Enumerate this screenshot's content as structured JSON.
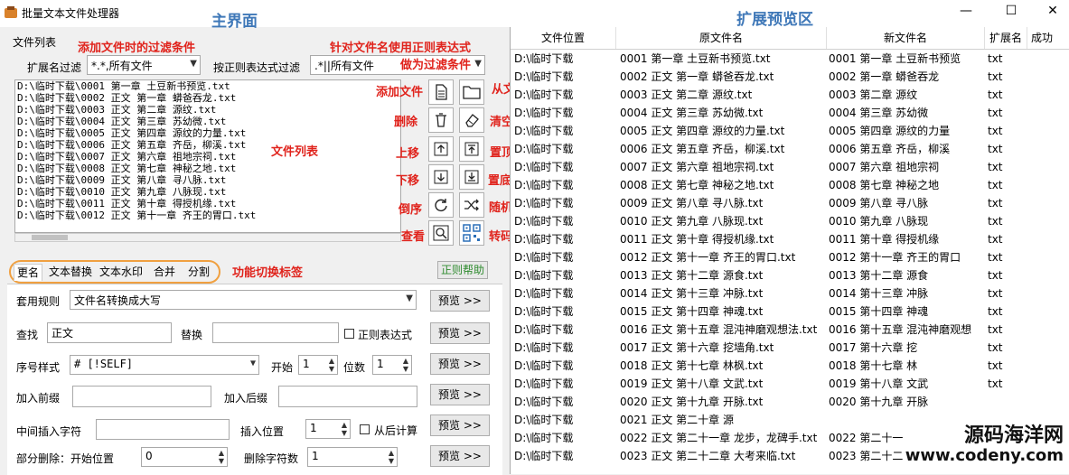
{
  "window": {
    "title": "批量文本文件处理器",
    "minimize": "—",
    "maximize": "☐",
    "close": "✕"
  },
  "annotations": {
    "main": "主界面",
    "preview": "扩展预览区",
    "filter_note": "添加文件时的过滤条件",
    "regex_note": "针对文件名使用正则表达式",
    "regex_note2": "做为过滤条件",
    "add_file": "添加文件",
    "add_folder": "从文件夹添加",
    "delete": "删除",
    "clear": "清空",
    "up": "上移",
    "top": "置顶",
    "down": "下移",
    "bottom": "置底",
    "reverse": "倒序",
    "random": "随机",
    "view": "查看",
    "transcode": "转码",
    "file_list": "文件列表",
    "tab_note": "功能切换标签"
  },
  "filter": {
    "section_label": "文件列表",
    "ext_label": "扩展名过滤",
    "ext_value": "*.*,所有文件",
    "regex_label": "按正则表达式过滤",
    "regex_value": ".*||所有文件"
  },
  "file_list": [
    "D:\\临时下载\\0001 第一章 土豆新书预览.txt",
    "D:\\临时下载\\0002 正文 第一章 蟒爸吞龙.txt",
    "D:\\临时下载\\0003 正文 第二章  源纹.txt",
    "D:\\临时下载\\0004 正文 第三章  苏幼微.txt",
    "D:\\临时下载\\0005 正文 第四章 源纹的力量.txt",
    "D:\\临时下载\\0006 正文 第五章  齐岳，柳溪.txt",
    "D:\\临时下载\\0007 正文 第六章  祖地宗祠.txt",
    "D:\\临时下载\\0008 正文 第七章 神秘之地.txt",
    "D:\\临时下载\\0009 正文 第八章 寻八脉.txt",
    "D:\\临时下载\\0010 正文 第九章  八脉现.txt",
    "D:\\临时下载\\0011 正文 第十章 得授机缘.txt",
    "D:\\临时下载\\0012 正文 第十一章  齐王的胃口.txt"
  ],
  "tabs": [
    "更名",
    "文本替换",
    "文本水印",
    "合并",
    "分割"
  ],
  "regex_help": "正则帮助",
  "rename": {
    "rule_label": "套用规则",
    "rule_value": "文件名转换成大写",
    "find_label": "查找",
    "find_value": "正文",
    "replace_label": "替换",
    "replace_value": "",
    "regex_check": "正则表达式",
    "seq_label": "序号样式",
    "seq_value": "# [!SELF]",
    "start_label": "开始",
    "start_value": "1",
    "digits_label": "位数",
    "digits_value": "1",
    "prefix_label": "加入前缀",
    "suffix_label": "加入后缀",
    "insert_label": "中间插入字符",
    "insert_pos_label": "插入位置",
    "insert_pos_value": "1",
    "from_end": "从后计算",
    "partdel_label": "部分删除：开始位置",
    "partdel_start": "0",
    "delcount_label": "删除字符数",
    "delcount_value": "1",
    "preview_btn": "预览 >>"
  },
  "grid": {
    "columns": [
      "文件位置",
      "原文件名",
      "新文件名",
      "扩展名",
      "成功"
    ],
    "rows": [
      [
        "D:\\临时下载",
        "0001 第一章 土豆新书预览.txt",
        "0001 第一章 土豆新书预览",
        "txt"
      ],
      [
        "D:\\临时下载",
        "0002 正文 第一章 蟒爸吞龙.txt",
        "0002 第一章 蟒爸吞龙",
        "txt"
      ],
      [
        "D:\\临时下载",
        "0003 正文 第二章  源纹.txt",
        "0003 第二章  源纹",
        "txt"
      ],
      [
        "D:\\临时下载",
        "0004 正文 第三章  苏幼微.txt",
        "0004 第三章  苏幼微",
        "txt"
      ],
      [
        "D:\\临时下载",
        "0005 正文 第四章 源纹的力量.txt",
        "0005 第四章 源纹的力量",
        "txt"
      ],
      [
        "D:\\临时下载",
        "0006 正文 第五章  齐岳，柳溪.txt",
        "0006 第五章  齐岳，柳溪",
        "txt"
      ],
      [
        "D:\\临时下载",
        "0007 正文 第六章  祖地宗祠.txt",
        "0007 第六章  祖地宗祠",
        "txt"
      ],
      [
        "D:\\临时下载",
        "0008 正文 第七章 神秘之地.txt",
        "0008 第七章 神秘之地",
        "txt"
      ],
      [
        "D:\\临时下载",
        "0009 正文 第八章 寻八脉.txt",
        "0009 第八章 寻八脉",
        "txt"
      ],
      [
        "D:\\临时下载",
        "0010 正文 第九章  八脉现.txt",
        "0010 第九章  八脉现",
        "txt"
      ],
      [
        "D:\\临时下载",
        "0011 正文 第十章 得授机缘.txt",
        "0011 第十章 得授机缘",
        "txt"
      ],
      [
        "D:\\临时下载",
        "0012 正文 第十一章  齐王的胃口.txt",
        "0012 第十一章  齐王的胃口",
        "txt"
      ],
      [
        "D:\\临时下载",
        "0013 正文 第十二章  源食.txt",
        "0013 第十二章  源食",
        "txt"
      ],
      [
        "D:\\临时下载",
        "0014 正文 第十三章  冲脉.txt",
        "0014 第十三章  冲脉",
        "txt"
      ],
      [
        "D:\\临时下载",
        "0015 正文 第十四章  神魂.txt",
        "0015 第十四章  神魂",
        "txt"
      ],
      [
        "D:\\临时下载",
        "0016 正文 第十五章  混沌神磨观想法.txt",
        "0016 第十五章  混沌神磨观想",
        "txt"
      ],
      [
        "D:\\临时下载",
        "0017 正文 第十六章 挖墙角.txt",
        "0017 第十六章 挖",
        "txt"
      ],
      [
        "D:\\临时下载",
        "0018 正文 第十七章  林枫.txt",
        "0018 第十七章  林",
        "txt"
      ],
      [
        "D:\\临时下载",
        "0019 正文 第十八章  文武.txt",
        "0019 第十八章  文武",
        "txt"
      ],
      [
        "D:\\临时下载",
        "0020 正文 第十九章  开脉.txt",
        "0020 第十九章  开脉",
        ""
      ],
      [
        "D:\\临时下载",
        "0021 正文 第二十章  源",
        "",
        ""
      ],
      [
        "D:\\临时下载",
        "0022 正文 第二十一章  龙步，龙碑手.txt",
        "0022 第二十一",
        ""
      ],
      [
        "D:\\临时下载",
        "0023 正文 第二十二章  大考来临.txt",
        "0023 第二十二",
        ""
      ]
    ]
  },
  "watermark": {
    "line1": "源码海洋网",
    "line2": "www.codeny.com"
  },
  "colors": {
    "annotation_red": "#e0231c",
    "annotation_blue": "#3f78b8",
    "tab_highlight": "#f0a040",
    "help_green": "#2e8b2e"
  }
}
